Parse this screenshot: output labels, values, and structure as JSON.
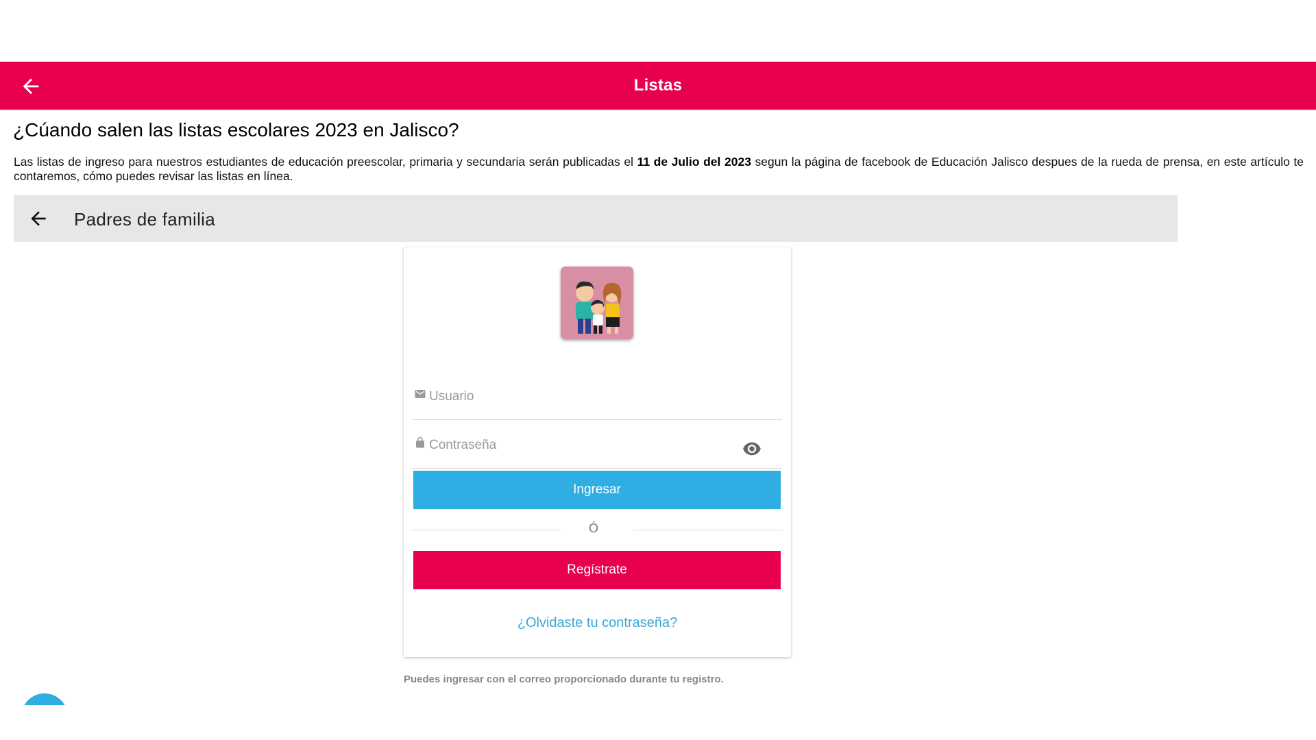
{
  "appbar": {
    "title": "Listas",
    "back_icon": "arrow-left-icon",
    "color": "#e8004d"
  },
  "article": {
    "heading": "¿Cúando salen las listas escolares 2023 en Jalisco?",
    "body_before": "Las listas de ingreso para nuestros estudiantes de educación preescolar, primaria y secundaria serán publicadas el ",
    "body_bold": "11 de Julio del 2023",
    "body_after": " segun la página de facebook de Educación Jalisco despues de la rueda de prensa, en este artículo te contaremos, cómo puedes revisar las listas en línea."
  },
  "screenshot": {
    "header_title": "Padres de familia",
    "login": {
      "avatar": "family-illustration",
      "username_placeholder": "Usuario",
      "password_placeholder": "Contraseña",
      "login_button": "Ingresar",
      "divider": "Ó",
      "register_button": "Regístrate",
      "forgot_link": "¿Olvidaste tu contraseña?",
      "login_color": "#2eaee2",
      "register_color": "#e8004d"
    },
    "note": "Puedes ingresar con el correo proporcionado durante tu registro."
  }
}
